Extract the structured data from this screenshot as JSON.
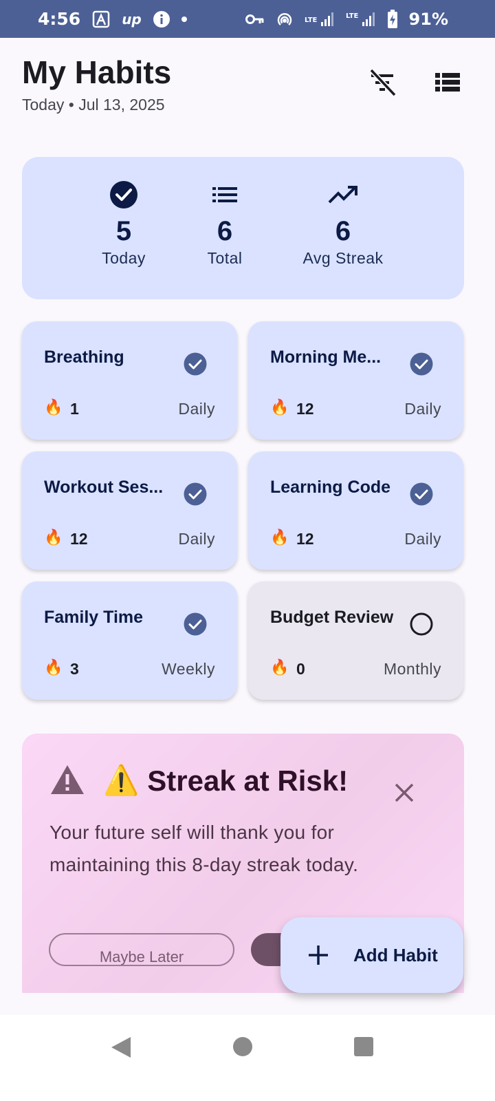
{
  "status_bar": {
    "time": "4:56",
    "battery": "91%",
    "icons": [
      "rider-icon",
      "up-icon",
      "info-icon",
      "dot-icon",
      "vpn-key-icon",
      "hotspot-icon",
      "lte-signal-icon",
      "lte-signal-icon",
      "battery-charging-icon"
    ],
    "up_text": "up",
    "lte": "LTE"
  },
  "header": {
    "title": "My Habits",
    "subtitle": "Today • Jul 13, 2025",
    "filter_icon": "filter-off-icon",
    "list_icon": "view-list-icon"
  },
  "stats": [
    {
      "icon": "check-circle-icon",
      "value": "5",
      "label": "Today"
    },
    {
      "icon": "list-icon",
      "value": "6",
      "label": "Total"
    },
    {
      "icon": "trending-up-icon",
      "value": "6",
      "label": "Avg Streak"
    }
  ],
  "habits": [
    {
      "name": "Breathing",
      "streak": "1",
      "frequency": "Daily",
      "done": true
    },
    {
      "name": "Morning Me...",
      "streak": "12",
      "frequency": "Daily",
      "done": true
    },
    {
      "name": "Workout Ses...",
      "streak": "12",
      "frequency": "Daily",
      "done": true
    },
    {
      "name": "Learning Code",
      "streak": "12",
      "frequency": "Daily",
      "done": true
    },
    {
      "name": "Family Time",
      "streak": "3",
      "frequency": "Weekly",
      "done": true
    },
    {
      "name": "Budget Review",
      "streak": "0",
      "frequency": "Monthly",
      "done": false
    }
  ],
  "alert": {
    "emoji": "⚠️",
    "title": "Streak at Risk!",
    "message": "Your future self will thank you for maintaining this 8-day streak today.",
    "secondary_button": "Maybe Later",
    "close_icon": "close-icon",
    "warning_icon": "warning-icon"
  },
  "fab": {
    "label": "Add Habit",
    "icon": "plus-icon"
  },
  "colors": {
    "status_bar": "#4c6096",
    "card": "#dae2ff",
    "card_pending": "#eae7f0",
    "check": "#4c6096",
    "alert_bg": "#fad8f6",
    "alert_btn": "#6e5066"
  }
}
